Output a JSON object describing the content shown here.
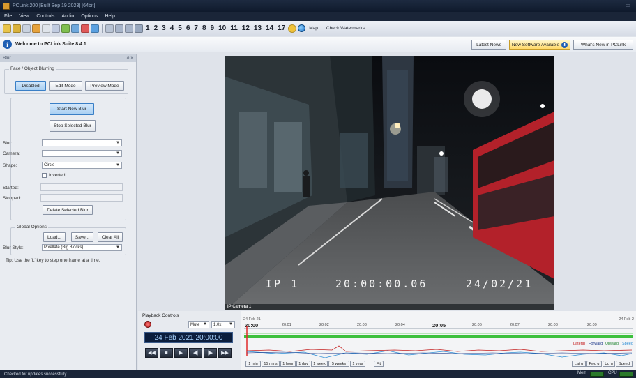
{
  "window": {
    "title": "PCLink 200 [Built Sep 19 2023] [64bit]",
    "controls": [
      "_",
      "▭"
    ]
  },
  "menu": [
    "File",
    "View",
    "Controls",
    "Audio",
    "Options",
    "Help"
  ],
  "toolbar": {
    "numbers": [
      "1",
      "2",
      "3",
      "4",
      "5",
      "6",
      "7",
      "8",
      "9",
      "10",
      "11",
      "12",
      "13",
      "14",
      "17"
    ],
    "map_label": "Map",
    "watermark_label": "Check Watermarks"
  },
  "infostrip": {
    "welcome": "Welcome to PCLink Suite 8.4.1",
    "latest_news": "Latest News",
    "new_software": "New Software Available",
    "whats_new": "What's New in PCLink"
  },
  "blur_panel": {
    "title": "Blur",
    "header_controls": "# ×",
    "face_group": "Face / Object Blurring",
    "mode_buttons": [
      "Disabled",
      "Edit Mode",
      "Preview Mode"
    ],
    "start_new": "Start New Blur",
    "stop_selected": "Stop Selected Blur",
    "blur_label": "Blur:",
    "camera_label": "Camera:",
    "shape_label": "Shape:",
    "shape_value": "Circle",
    "inverted_label": "Inverted",
    "started_label": "Started:",
    "stopped_label": "Stopped:",
    "delete_selected": "Delete Selected Blur",
    "global_group": "Global Options",
    "load": "Load...",
    "save": "Save...",
    "clear_all": "Clear All",
    "blur_style_label": "Blur Style:",
    "blur_style_value": "Pixellate (Big Blocks)",
    "tip": "Tip: Use the 'L' key to step one frame at a time."
  },
  "video": {
    "osd_camera": "IP 1",
    "osd_time": "20:00:00.06",
    "osd_date": "24/02/21",
    "camera_label": "IP Camera 1"
  },
  "playback": {
    "title": "Playback Controls",
    "mute": "Mute",
    "speed": "1.0x",
    "datetime": "24 Feb 2021  20:00:00",
    "buttons": [
      "◀◀",
      "■",
      "▶",
      "◀|",
      "|▶",
      "▶▶"
    ]
  },
  "timeline": {
    "date_left": "24 Feb 21",
    "date_right": "24 Feb 2",
    "ticks": [
      "20:00",
      "20:01",
      "20:02",
      "20:03",
      "20:04",
      "20:05",
      "20:06",
      "20:07",
      "20:08",
      "20:09"
    ],
    "legend": [
      "Lateral",
      "Forward",
      "Upward",
      "Speed"
    ],
    "legend_colors": [
      "#c42020",
      "#1f3a8a",
      "#2a8a3a",
      "#2f8fd6"
    ],
    "zoom_tabs": [
      "1 min",
      "15 mins",
      "1 hour",
      "1 day",
      "1 week",
      "5 weeks",
      "1 year",
      "Fit"
    ],
    "sensor_tabs": [
      "Lat g",
      "Fwd g",
      "Up g",
      "Speed"
    ]
  },
  "status": {
    "message": "Checked for updates successfully",
    "mem": "Mem",
    "cpu": "CPU"
  }
}
